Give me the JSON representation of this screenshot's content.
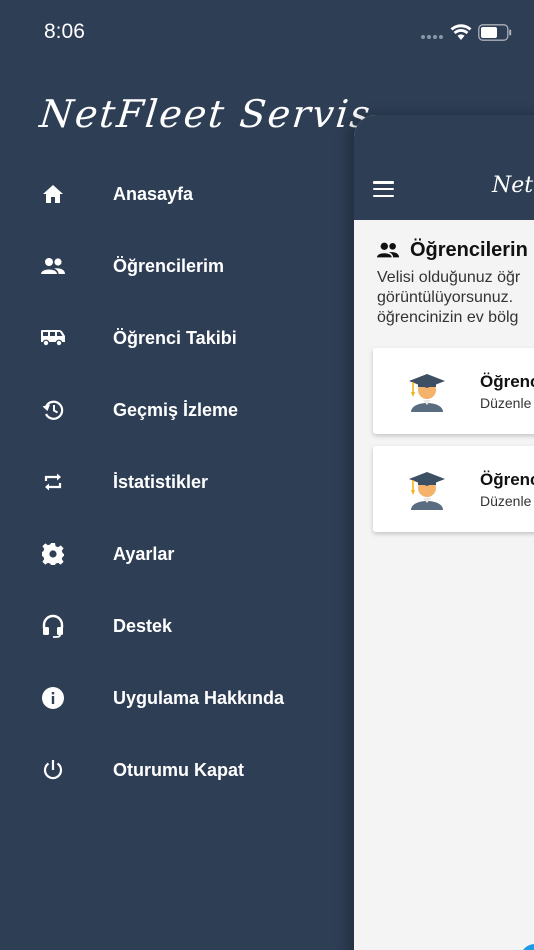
{
  "status": {
    "time": "8:06"
  },
  "drawer": {
    "brand": "NetFleet Servis",
    "items": [
      {
        "label": "Anasayfa",
        "icon": "home-icon"
      },
      {
        "label": "Öğrencilerim",
        "icon": "people-icon"
      },
      {
        "label": "Öğrenci Takibi",
        "icon": "bus-icon"
      },
      {
        "label": "Geçmiş İzleme",
        "icon": "history-icon"
      },
      {
        "label": "İstatistikler",
        "icon": "repeat-icon"
      },
      {
        "label": "Ayarlar",
        "icon": "gear-icon"
      },
      {
        "label": "Destek",
        "icon": "headset-icon"
      },
      {
        "label": "Uygulama Hakkında",
        "icon": "info-icon"
      },
      {
        "label": "Oturumu Kapat",
        "icon": "power-icon"
      }
    ]
  },
  "main": {
    "brand_partial": "Net",
    "section_title": "Öğrencilerin",
    "description_lines": [
      "Velisi olduğunuz öğr",
      "görüntülüyorsunuz.",
      "öğrencinizin ev bölg"
    ],
    "cards": [
      {
        "title": "Öğrenc",
        "subtitle": "Düzenle"
      },
      {
        "title": "Öğrenc",
        "subtitle": "Düzenle"
      }
    ]
  },
  "colors": {
    "drawer_bg": "#2e3e55",
    "content_bg": "#f4f4f4",
    "accent": "#1e9be6"
  }
}
